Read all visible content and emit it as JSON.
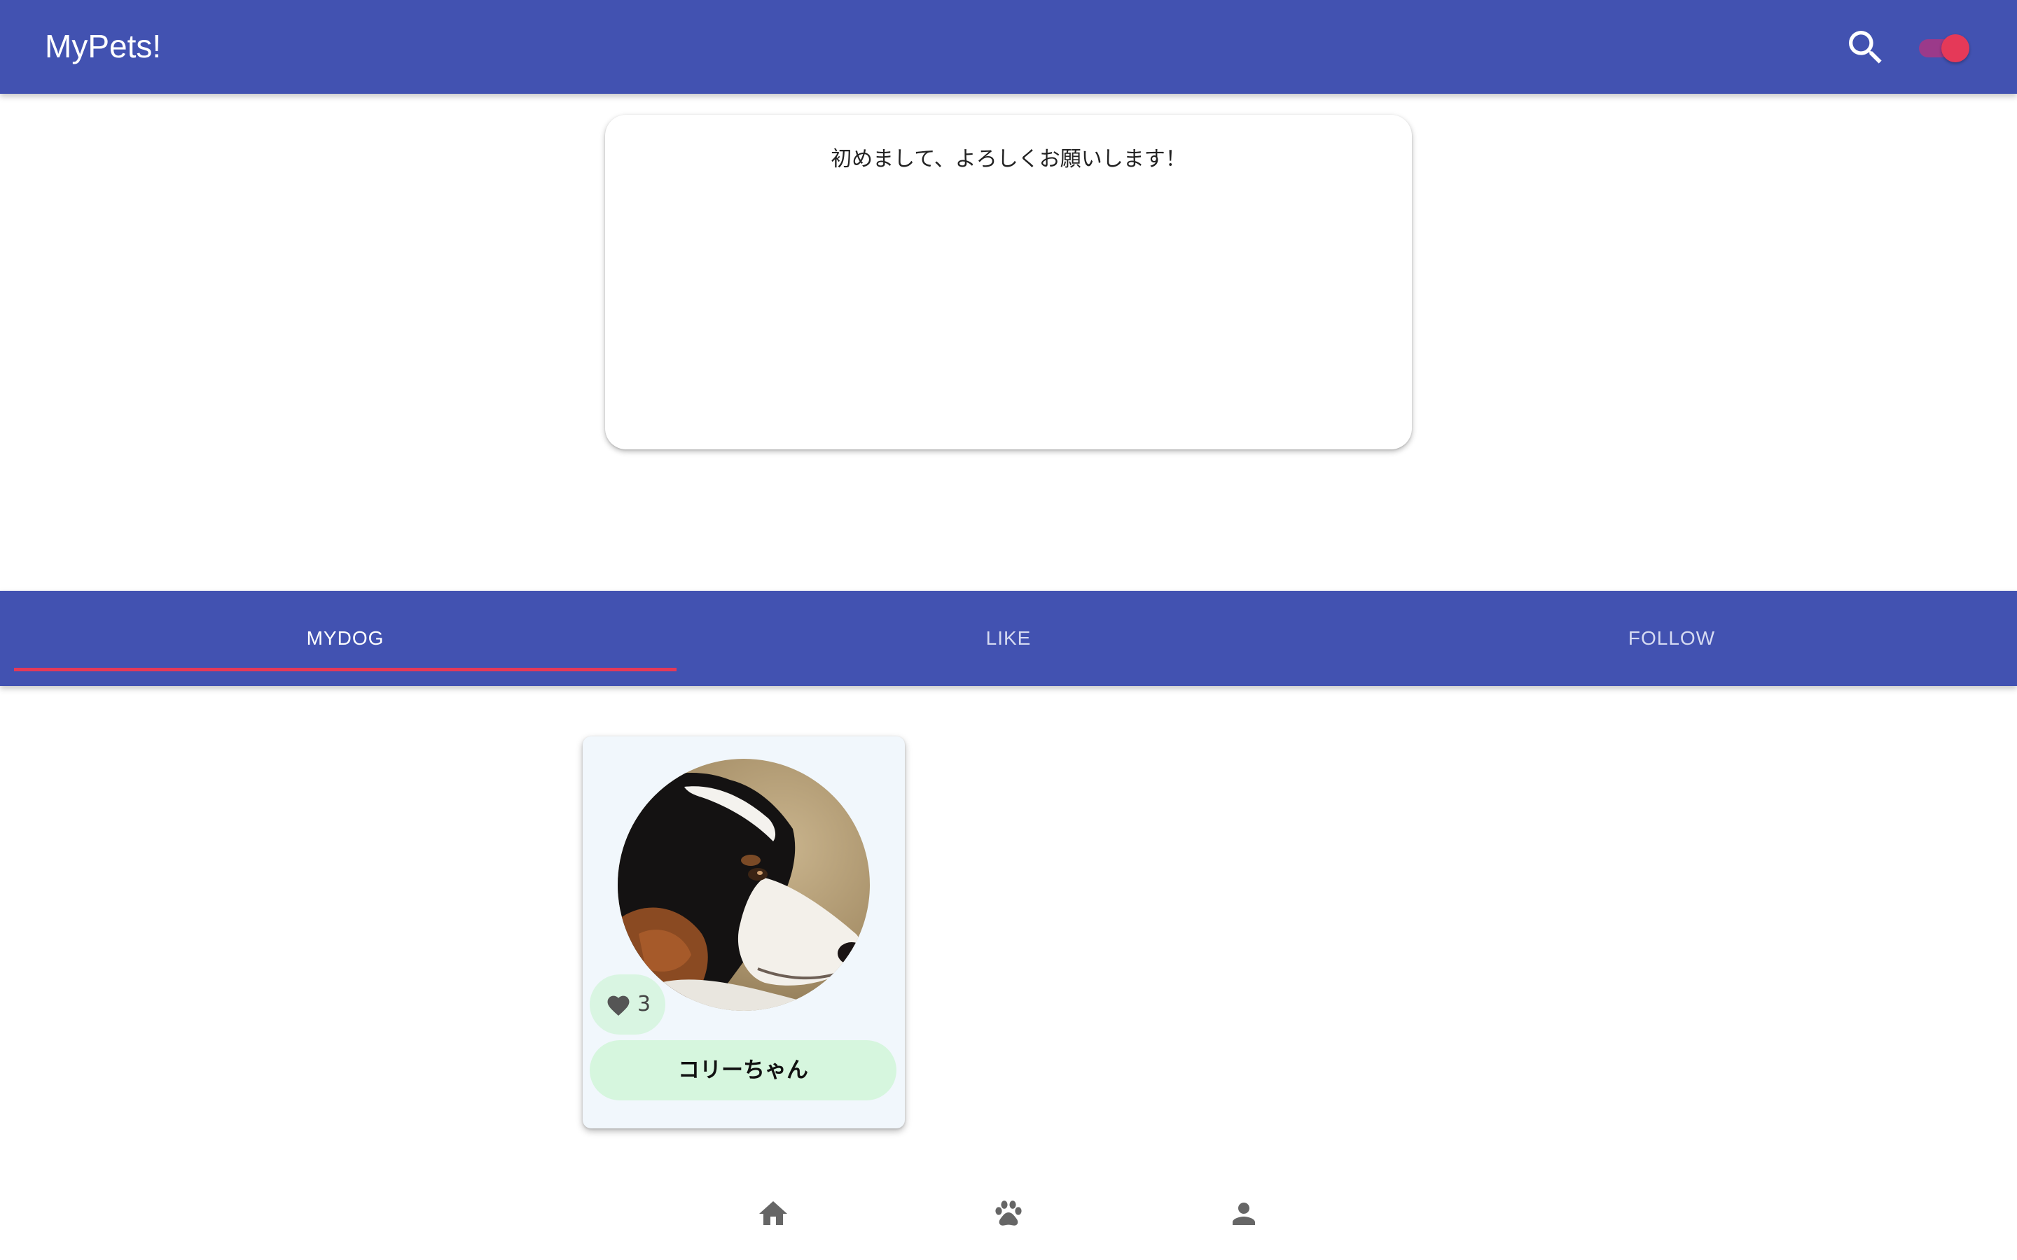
{
  "app_bar": {
    "title": "MyPets!",
    "search_icon": "search-icon",
    "theme_toggle": {
      "on": true
    }
  },
  "greeting": {
    "text": "初めまして、よろしくお願いします！"
  },
  "tabs": [
    {
      "label": "MYDOG",
      "selected": true
    },
    {
      "label": "LIKE",
      "selected": false
    },
    {
      "label": "FOLLOW",
      "selected": false
    }
  ],
  "pet_card": {
    "name": "コリーちゃん",
    "likes": "3",
    "like_icon": "heart-icon"
  },
  "bottom_nav": {
    "items": [
      {
        "icon": "home-icon"
      },
      {
        "icon": "paw-icon"
      },
      {
        "icon": "person-icon"
      }
    ]
  },
  "colors": {
    "primary": "#4252B1",
    "accent": "#E53958",
    "card_background": "#F1F7FC",
    "chip_background": "#D6F6DE",
    "tab_selected_text": "#FFFFFF",
    "tab_unselected_text": "#D6DBF2"
  }
}
